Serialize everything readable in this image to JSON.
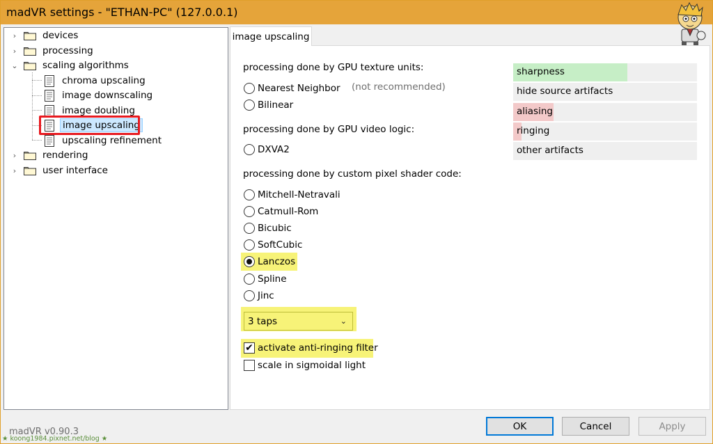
{
  "window": {
    "title": "madVR settings - \"ETHAN-PC\" (127.0.0.1)"
  },
  "tree": {
    "items": [
      {
        "label": "devices",
        "type": "folder",
        "expanded": false
      },
      {
        "label": "processing",
        "type": "folder",
        "expanded": false
      },
      {
        "label": "scaling algorithms",
        "type": "folder",
        "expanded": true,
        "children": [
          {
            "label": "chroma upscaling"
          },
          {
            "label": "image downscaling"
          },
          {
            "label": "image doubling"
          },
          {
            "label": "image upscaling",
            "selected": true
          },
          {
            "label": "upscaling refinement"
          }
        ]
      },
      {
        "label": "rendering",
        "type": "folder",
        "expanded": false
      },
      {
        "label": "user interface",
        "type": "folder",
        "expanded": false
      }
    ]
  },
  "tab": {
    "label": "image upscaling"
  },
  "content": {
    "group_texture": "processing done by GPU texture units:",
    "nearest_neighbor": "Nearest Neighbor",
    "not_recommended": "(not recommended)",
    "bilinear": "Bilinear",
    "group_video_logic": "processing done by GPU video logic:",
    "dxva2": "DXVA2",
    "group_pixel_shader": "processing done by custom pixel shader code:",
    "shader_options": [
      "Mitchell-Netravali",
      "Catmull-Rom",
      "Bicubic",
      "SoftCubic",
      "Lanczos",
      "Spline",
      "Jinc"
    ],
    "selected_option": "Lanczos",
    "taps_value": "3 taps",
    "anti_ringing_label": "activate anti-ringing filter",
    "anti_ringing_checked": true,
    "sigmoidal_label": "scale in sigmoidal light",
    "sigmoidal_checked": false
  },
  "legend": {
    "rows": [
      {
        "label": "sharpness",
        "color": "#c6eec6",
        "level": 0.62
      },
      {
        "label": "hide source artifacts",
        "color": "#efefef",
        "level": 0
      },
      {
        "label": "aliasing",
        "color": "#f3c9c9",
        "level": 0.22
      },
      {
        "label": "ringing",
        "color": "#f3c9c9",
        "level": 0.05
      },
      {
        "label": "other artifacts",
        "color": "#efefef",
        "level": 0
      }
    ]
  },
  "footer": {
    "version": "madVR v0.90.3",
    "watermark": "★ koong1984.pixnet.net/blog ★",
    "ok": "OK",
    "cancel": "Cancel",
    "apply": "Apply"
  },
  "colors": {
    "titlebar": "#e5a43a",
    "highlight": "#f7f378",
    "selection": "#cce8ff",
    "annotation_red": "#e8191f",
    "default_button_border": "#0078d7"
  }
}
